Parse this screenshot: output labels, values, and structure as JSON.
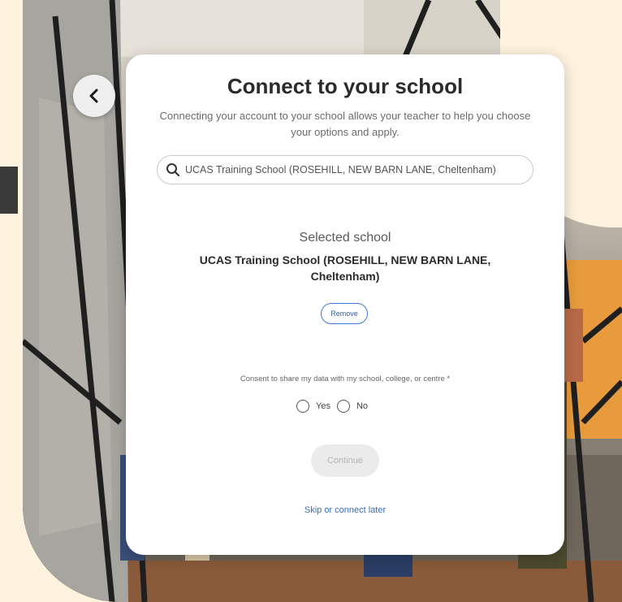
{
  "page": {
    "title": "Connect to your school",
    "subtitle": "Connecting your account to your school allows your teacher to help you choose your options and apply."
  },
  "search": {
    "value": "UCAS Training School (ROSEHILL, NEW BARN LANE, Cheltenham)",
    "icon": "search-icon"
  },
  "selected": {
    "label": "Selected school",
    "name": "UCAS Training School (ROSEHILL, NEW BARN LANE, Cheltenham)",
    "remove_label": "Remove"
  },
  "consent": {
    "question": "Consent to share my data with my school, college, or centre *",
    "options": [
      "Yes",
      "No"
    ]
  },
  "actions": {
    "continue_label": "Continue",
    "skip_label": "Skip or connect later"
  },
  "nav": {
    "back_icon": "chevron-left-icon"
  },
  "colors": {
    "link": "#3a6fb8",
    "remove_border": "#3a7bd5",
    "background_cream": "#fdf3df"
  }
}
